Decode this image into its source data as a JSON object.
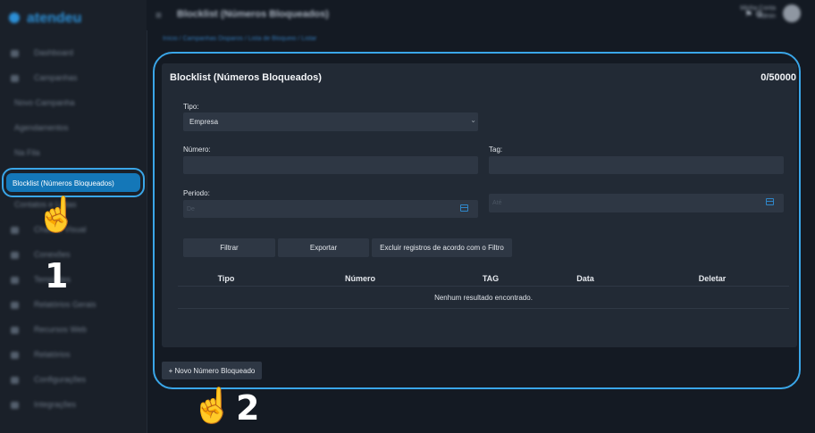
{
  "sidebar": {
    "logo": "atendeu",
    "items": [
      {
        "label": "Dashboard",
        "sub": false
      },
      {
        "label": "Campanhas",
        "sub": false
      },
      {
        "label": "Novo Campanha",
        "sub": true
      },
      {
        "label": "Agendamentos",
        "sub": true
      },
      {
        "label": "Na Fila",
        "sub": true
      }
    ],
    "active_label": "Blocklist (Números Bloqueados)",
    "items_after": [
      {
        "label": "Contatos e Listas",
        "sub": true
      },
      {
        "label": "Chatbot Visual",
        "sub": false
      },
      {
        "label": "Conexões",
        "sub": false
      },
      {
        "label": "Templates",
        "sub": false
      },
      {
        "label": "Relatórios Gerais",
        "sub": false
      },
      {
        "label": "Recursos Web",
        "sub": false
      },
      {
        "label": "Relatórios",
        "sub": false
      },
      {
        "label": "Configurações",
        "sub": false
      },
      {
        "label": "Integrações",
        "sub": false
      }
    ]
  },
  "header": {
    "menu_icon": "≡",
    "title": "Blocklist (Números Bloqueados)",
    "icons": "⚑ ⚙",
    "user_line1": "Minha Conta",
    "user_line2": "Admin"
  },
  "breadcrumb": "Início  /  Campanhas Disparos  /  Lista de Bloqueio  /  Listar",
  "card": {
    "title": "Blocklist (Números Bloqueados)",
    "count": "0/50000",
    "tipo_label": "Tipo:",
    "tipo_value": "Empresa",
    "numero_label": "Número:",
    "tag_label": "Tag:",
    "periodo_label": "Periodo:",
    "de_placeholder": "De",
    "ate_placeholder": "Até",
    "buttons": {
      "filtrar": "Filtrar",
      "exportar": "Exportar",
      "excluir": "Excluir registros de acordo com o Filtro"
    },
    "table": {
      "columns": [
        "Tipo",
        "Número",
        "TAG",
        "Data",
        "Deletar"
      ],
      "empty": "Nenhum resultado encontrado."
    }
  },
  "new_button": "+ Novo Número Bloqueado",
  "annotations": {
    "hand": "☝️",
    "step1": "1",
    "step2": "2"
  },
  "colors": {
    "accent": "#3aa6e8",
    "active_item": "#1477b8",
    "card": "#222a35",
    "field": "#2e3744"
  }
}
